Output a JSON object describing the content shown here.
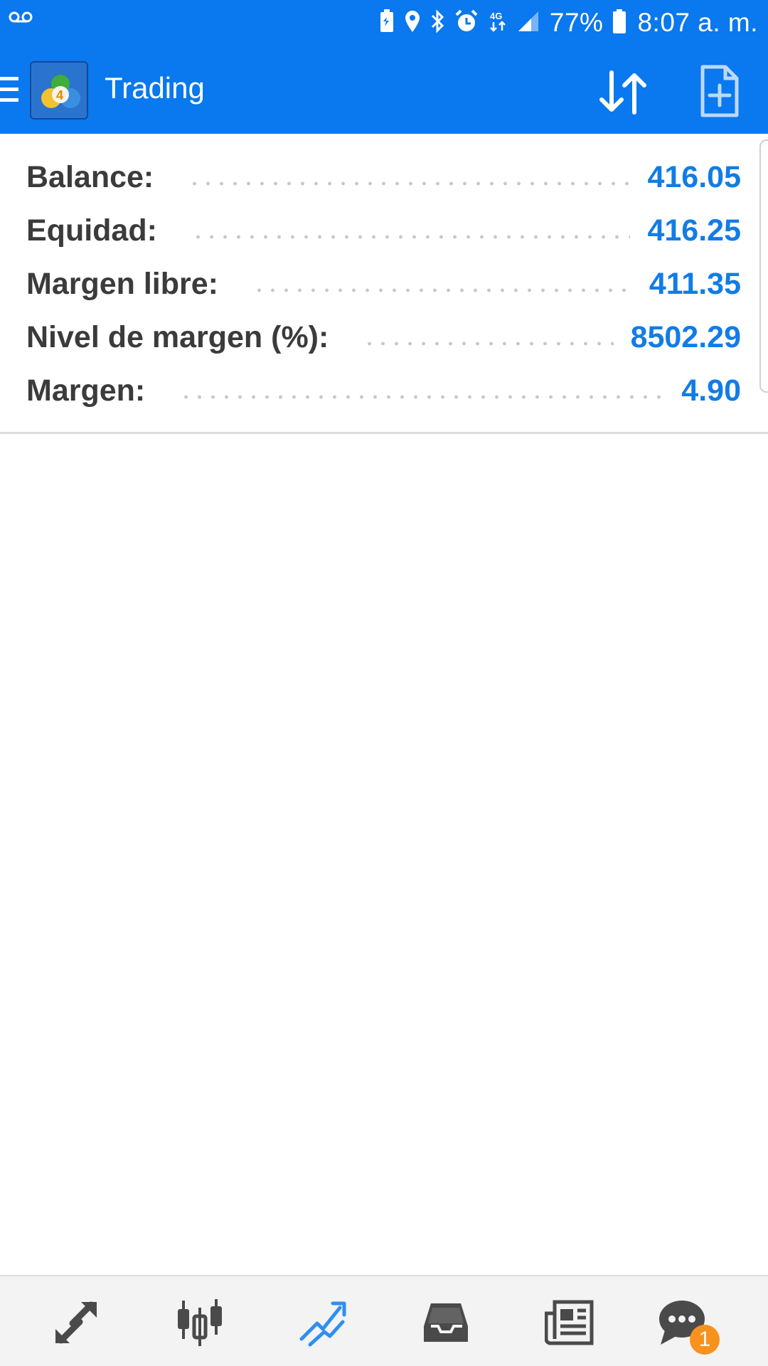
{
  "status_bar": {
    "battery_percent": "77%",
    "time": "8:07 a. m.",
    "icons": [
      "voicemail-icon",
      "battery-saver-icon",
      "location-icon",
      "bluetooth-icon",
      "alarm-icon",
      "4g-icon",
      "signal-icon",
      "battery-icon"
    ]
  },
  "app_bar": {
    "title": "Trading",
    "icons": [
      "menu-icon",
      "metatrader-logo",
      "sort-icon",
      "new-order-icon"
    ]
  },
  "summary": {
    "rows": [
      {
        "label": "Balance:",
        "value": "416.05"
      },
      {
        "label": "Equidad:",
        "value": "416.25"
      },
      {
        "label": "Margen libre:",
        "value": "411.35"
      },
      {
        "label": "Nivel de margen (%):",
        "value": "8502.29"
      },
      {
        "label": "Margen:",
        "value": "4.90"
      }
    ]
  },
  "bottom_nav": {
    "items": [
      "quotes-icon",
      "chart-icon",
      "trade-icon",
      "history-icon",
      "news-icon",
      "chat-icon"
    ],
    "active": "trade-icon",
    "chat_badge": "1"
  },
  "colors": {
    "primary": "#0a78ee",
    "value_blue": "#127ce6",
    "label_dark": "#3b3b3b",
    "badge_orange": "#f7921e"
  }
}
